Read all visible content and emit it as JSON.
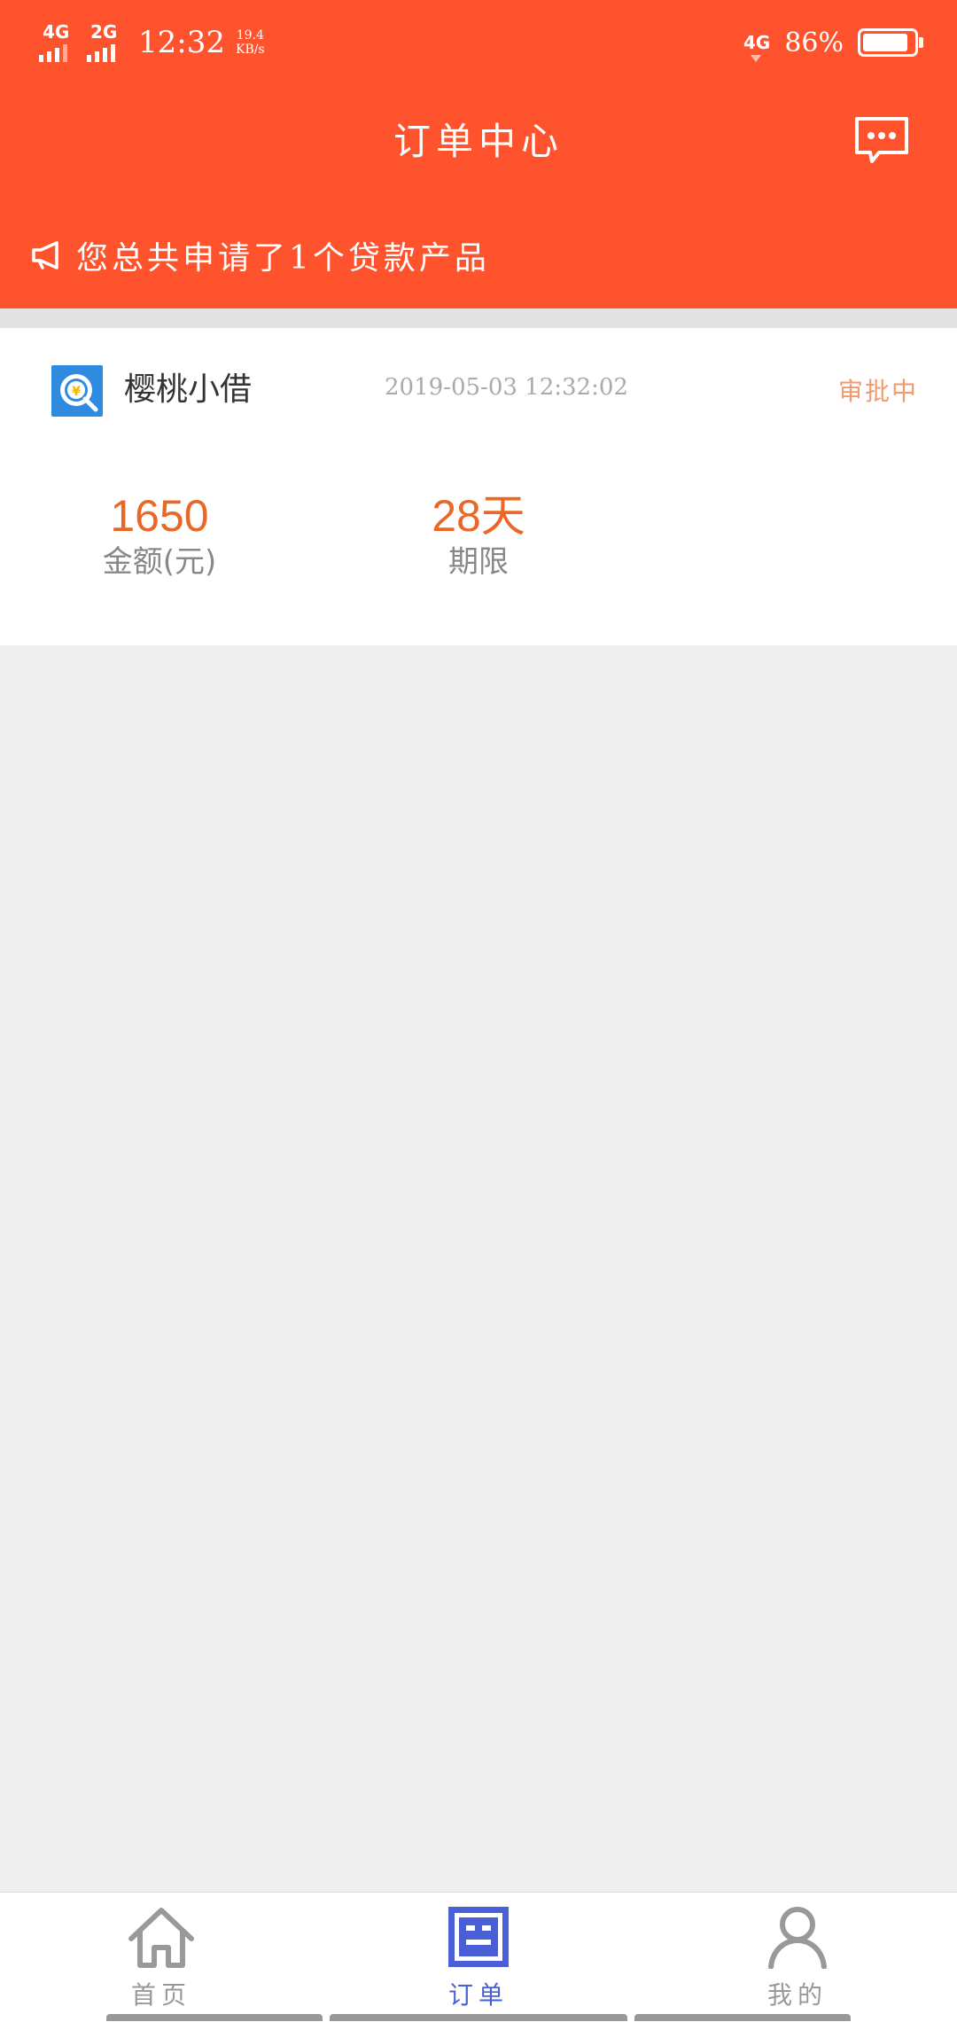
{
  "status_bar": {
    "net1": "4G",
    "net2": "2G",
    "time": "12:32",
    "speed_value": "19.4",
    "speed_unit": "KB/s",
    "net3": "4G",
    "battery": "86%"
  },
  "header": {
    "title": "订单中心",
    "notice": "您总共申请了1个贷款产品",
    "message_icon": "chat-bubble-icon",
    "notice_icon": "megaphone-icon"
  },
  "order": {
    "name": "樱桃小借",
    "date": "2019-05-03 12:32:02",
    "status": "审批中",
    "amount_value": "1650",
    "amount_label": "金额(元)",
    "term_value": "28天",
    "term_label": "期限"
  },
  "nav": {
    "items": [
      {
        "label": "首页",
        "icon": "home-icon",
        "active": false
      },
      {
        "label": "订单",
        "icon": "order-list-icon",
        "active": true
      },
      {
        "label": "我的",
        "icon": "person-icon",
        "active": false
      }
    ]
  },
  "colors": {
    "brand": "#ff532d",
    "accent_value": "#ea6725",
    "status": "#f29a6e",
    "nav_active": "#4a5fd6",
    "nav_inactive": "#999999"
  }
}
